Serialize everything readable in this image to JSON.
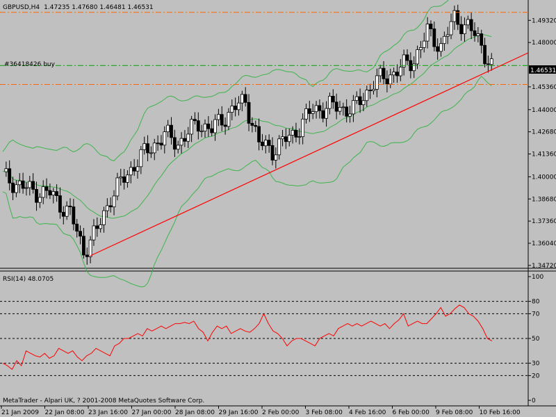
{
  "window": {
    "symbol_title": "GBPUSD,H4",
    "ohlc": "1.47235 1.47680 1.46481 1.46531",
    "order_label": "#36418426 buy",
    "current_price": "1.46531",
    "footer": "MetaTrader - Alpari UK, ? 2001-2008 MetaQuotes Software Corp."
  },
  "rsi": {
    "title": "RSI(14) 48.0705",
    "levels": [
      "100",
      "80",
      "70",
      "50",
      "30",
      "20",
      "0"
    ]
  },
  "colors": {
    "chart_bg": "#c0c0c0",
    "candle_bull": "#ffffff",
    "candle_bear": "#000000",
    "bollinger": "#3cb44b",
    "trendline": "#ff0000",
    "rsi_line": "#ff0000",
    "order_line": "#00a000",
    "level_line": "#ff6600"
  },
  "chart_data": {
    "type": "candlestick",
    "price_ticks": [
      "1.49320",
      "1.48000",
      "1.46531",
      "1.45360",
      "1.44000",
      "1.42680",
      "1.41360",
      "1.40000",
      "1.38680",
      "1.37360",
      "1.36040",
      "1.34720"
    ],
    "time_labels": [
      "21 Jan 2009",
      "22 Jan 08:00",
      "23 Jan 16:00",
      "27 Jan 00:00",
      "28 Jan 08:00",
      "29 Jan 16:00",
      "2 Feb 00:00",
      "3 Feb 08:00",
      "4 Feb 16:00",
      "6 Feb 00:00",
      "9 Feb 08:00",
      "10 Feb 16:00"
    ],
    "price_range": [
      1.3455,
      1.5045
    ],
    "order_level": 1.4663,
    "hlines": [
      1.498,
      1.455
    ],
    "rsi_values": [
      30,
      28,
      25,
      32,
      28,
      40,
      38,
      36,
      35,
      38,
      34,
      36,
      42,
      40,
      38,
      40,
      35,
      32,
      36,
      38,
      42,
      40,
      38,
      36,
      44,
      46,
      50,
      50,
      52,
      54,
      52,
      58,
      56,
      58,
      60,
      58,
      60,
      62,
      62,
      63,
      62,
      64,
      58,
      55,
      48,
      55,
      60,
      58,
      60,
      54,
      56,
      58,
      56,
      55,
      58,
      62,
      70,
      62,
      56,
      54,
      50,
      44,
      48,
      50,
      50,
      48,
      46,
      44,
      50,
      52,
      54,
      52,
      58,
      60,
      62,
      60,
      62,
      60,
      62,
      64,
      62,
      60,
      62,
      58,
      62,
      65,
      70,
      60,
      62,
      64,
      62,
      62,
      66,
      70,
      75,
      68,
      70,
      74,
      77,
      75,
      70,
      68,
      64,
      58,
      50,
      48
    ]
  }
}
